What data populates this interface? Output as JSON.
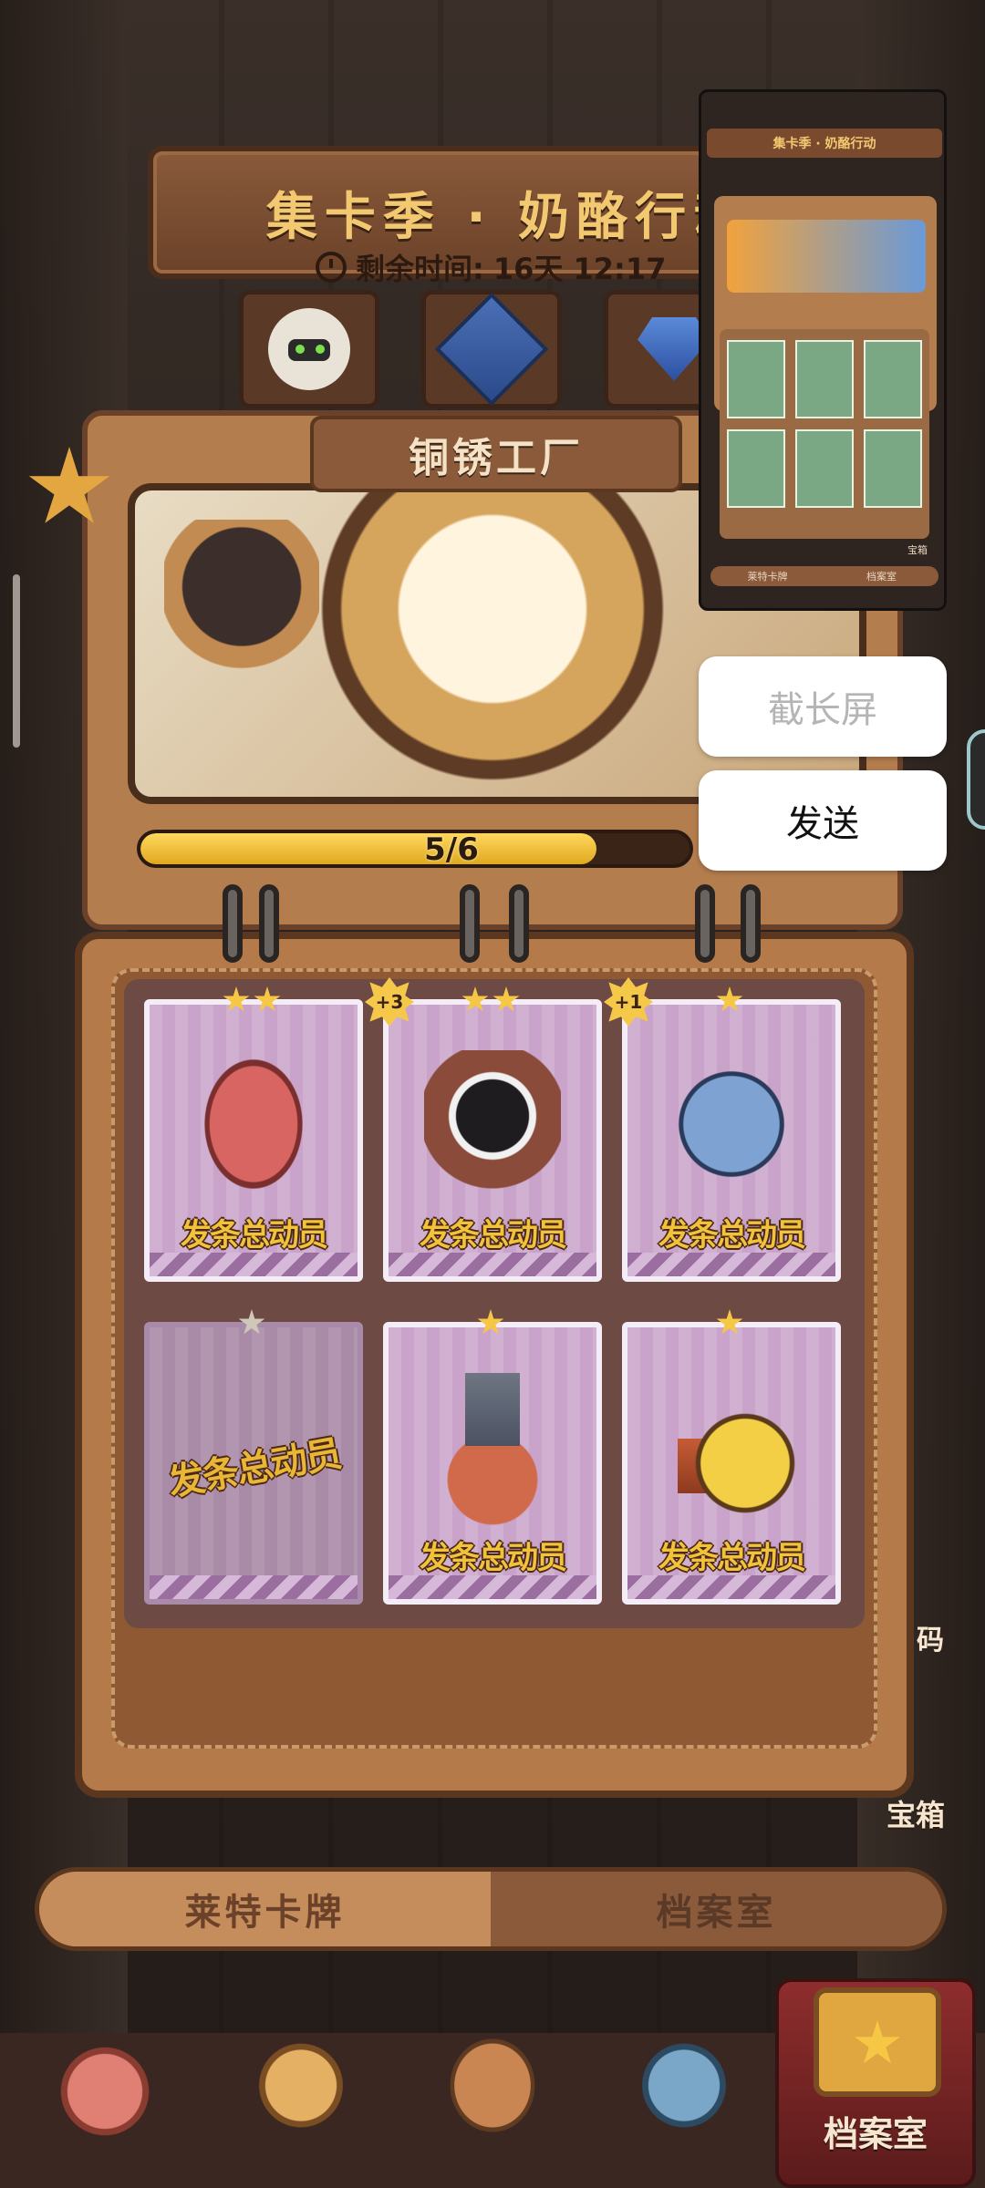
{
  "header": {
    "title": "集卡季 · 奶酪行动",
    "timer_prefix": "剩余时间:",
    "timer_value": "16天 12:17"
  },
  "panel": {
    "title": "铜锈工厂",
    "progress_text": "5/6",
    "progress_fraction": 0.83
  },
  "cards": [
    {
      "label": "发条总动员",
      "stars": 2,
      "badge": "",
      "locked": false,
      "art": "blimp-icon"
    },
    {
      "label": "发条总动员",
      "stars": 2,
      "badge": "+3",
      "locked": false,
      "art": "robot-plane-icon"
    },
    {
      "label": "发条总动员",
      "stars": 1,
      "badge": "+1",
      "locked": false,
      "art": "knight-icon"
    },
    {
      "label": "发条总动员",
      "stars": 1,
      "badge": "",
      "locked": true,
      "art": "locked-card"
    },
    {
      "label": "发条总动员",
      "stars": 1,
      "badge": "",
      "locked": false,
      "art": "bottle-icon"
    },
    {
      "label": "发条总动员",
      "stars": 1,
      "badge": "",
      "locked": false,
      "art": "bomb-clock-icon"
    }
  ],
  "tabs": [
    {
      "label": "莱特卡牌",
      "active": true
    },
    {
      "label": "档案室",
      "active": false
    }
  ],
  "side": {
    "chest_label": "宝箱",
    "badge_partial": "码"
  },
  "bottom_nav": {
    "archive_label": "档案室"
  },
  "screenshot_menu": {
    "long_screenshot": "截长屏",
    "send": "发送"
  },
  "thumbnail": {
    "title": "集卡季 · 奶酪行动",
    "tab1": "莱特卡牌",
    "tab2": "档案室",
    "corner_label": "宝箱"
  },
  "colors": {
    "accent_gold": "#f2c871",
    "wood_brown": "#b47d4e",
    "card_purple": "#c9a3c9",
    "progress_yellow": "#ffd85d"
  }
}
